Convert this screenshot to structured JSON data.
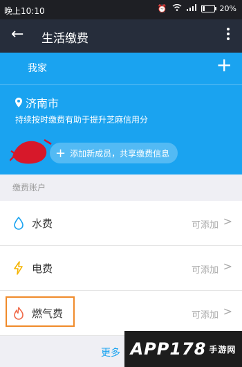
{
  "status_bar": {
    "time": "晚上10:10",
    "battery": "20%"
  },
  "top_bar": {
    "title": "生活缴费"
  },
  "home_card": {
    "group_name": "我家",
    "city": "济南市",
    "hint": "持续按时缴费有助于提升芝麻信用分",
    "add_member": "添加新成员，共享缴费信息"
  },
  "section": {
    "title": "缴费账户"
  },
  "accounts": [
    {
      "name": "水费",
      "status": "可添加",
      "icon": "water-drop-icon",
      "color": "#1aa3f0"
    },
    {
      "name": "电费",
      "status": "可添加",
      "icon": "lightning-icon",
      "color": "#f5b400"
    },
    {
      "name": "燃气费",
      "status": "可添加",
      "icon": "flame-icon",
      "color": "#f06a4a"
    }
  ],
  "more_link": "更多",
  "watermark": {
    "brand": "APP178",
    "site": "手游网"
  },
  "colors": {
    "primary": "#1aa3f0",
    "header": "#262d3b",
    "highlight": "#f08a2a"
  }
}
